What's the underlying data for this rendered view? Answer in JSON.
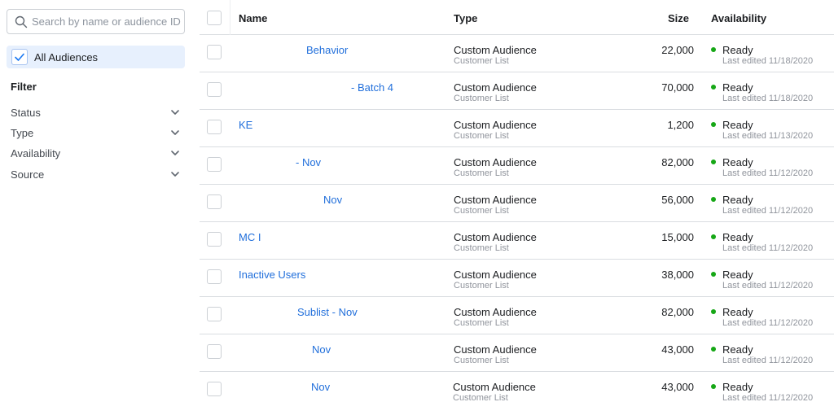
{
  "search": {
    "placeholder": "Search by name or audience ID",
    "value": ""
  },
  "all_audiences": {
    "label": "All Audiences",
    "checked": true
  },
  "filter": {
    "heading": "Filter",
    "items": [
      {
        "label": "Status"
      },
      {
        "label": "Type"
      },
      {
        "label": "Availability"
      },
      {
        "label": "Source"
      }
    ]
  },
  "table": {
    "columns": {
      "name": "Name",
      "type": "Type",
      "size": "Size",
      "availability": "Availability"
    },
    "rows": [
      {
        "name": "Behavior",
        "type": "Custom Audience",
        "subtype": "Customer List",
        "size": "22,000",
        "status": "Ready",
        "edited": "Last edited 11/18/2020"
      },
      {
        "name": "- Batch 4",
        "type": "Custom Audience",
        "subtype": "Customer List",
        "size": "70,000",
        "status": "Ready",
        "edited": "Last edited 11/18/2020"
      },
      {
        "name": "KE",
        "type": "Custom Audience",
        "subtype": "Customer List",
        "size": "1,200",
        "status": "Ready",
        "edited": "Last edited 11/13/2020"
      },
      {
        "name": "- Nov",
        "type": "Custom Audience",
        "subtype": "Customer List",
        "size": "82,000",
        "status": "Ready",
        "edited": "Last edited 11/12/2020"
      },
      {
        "name": "Nov",
        "type": "Custom Audience",
        "subtype": "Customer List",
        "size": "56,000",
        "status": "Ready",
        "edited": "Last edited 11/12/2020"
      },
      {
        "name": "MC I",
        "type": "Custom Audience",
        "subtype": "Customer List",
        "size": "15,000",
        "status": "Ready",
        "edited": "Last edited 11/12/2020"
      },
      {
        "name": "Inactive Users",
        "type": "Custom Audience",
        "subtype": "Customer List",
        "size": "38,000",
        "status": "Ready",
        "edited": "Last edited 11/12/2020"
      },
      {
        "name": "Sublist - Nov",
        "type": "Custom Audience",
        "subtype": "Customer List",
        "size": "82,000",
        "status": "Ready",
        "edited": "Last edited 11/12/2020"
      },
      {
        "name": "Nov",
        "type": "Custom Audience",
        "subtype": "Customer List",
        "size": "43,000",
        "status": "Ready",
        "edited": "Last edited 11/12/2020"
      },
      {
        "name": "Nov",
        "type": "Custom Audience",
        "subtype": "Customer List",
        "size": "43,000",
        "status": "Ready",
        "edited": "Last edited 11/12/2020"
      }
    ]
  },
  "colors": {
    "link": "#216fdb",
    "ready": "#16a716",
    "selected_bg": "#e7f0fd"
  },
  "icons": {
    "search": "search-icon",
    "check": "checkmark-icon",
    "chevron": "chevron-down-icon",
    "status": "status-dot-icon"
  }
}
